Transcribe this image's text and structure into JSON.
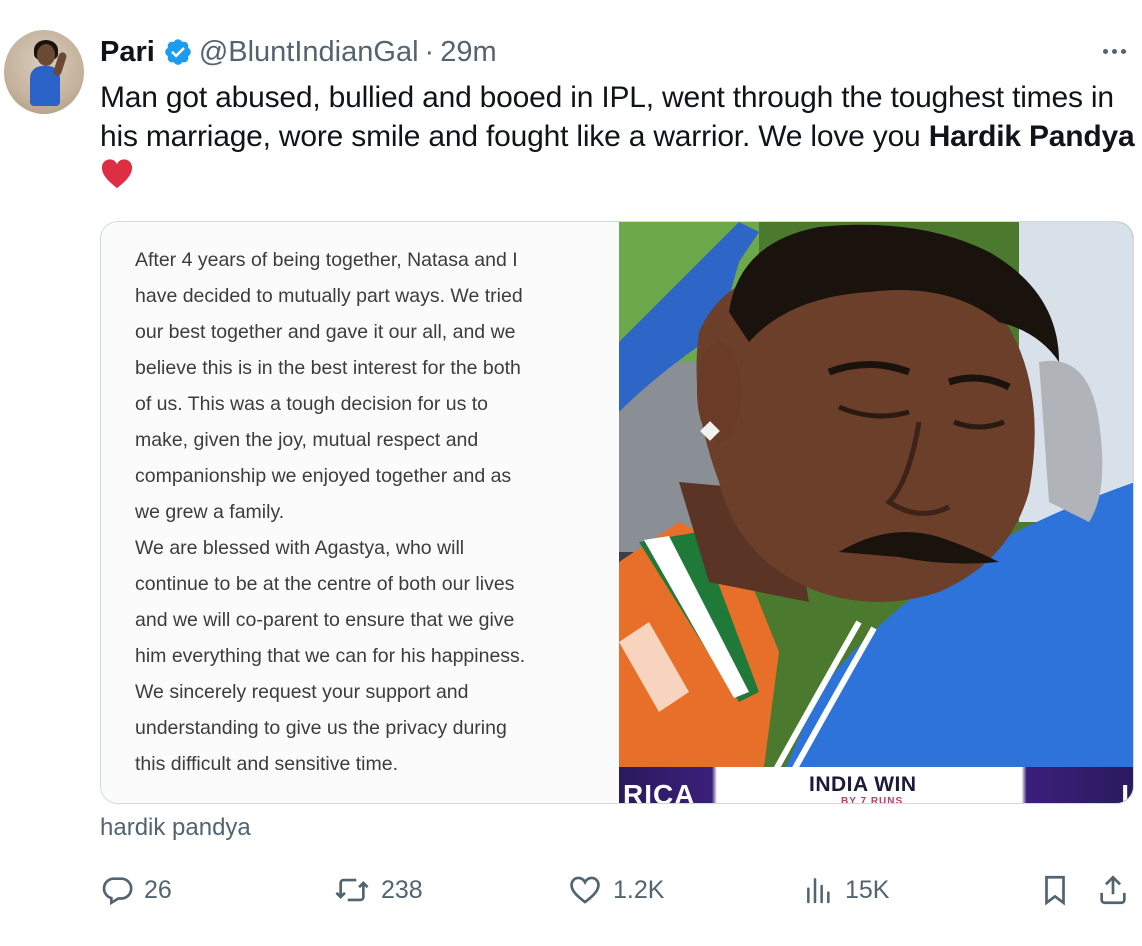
{
  "author": {
    "name": "Pari",
    "handle": "@BluntIndianGal",
    "separator": "·",
    "time": "29m"
  },
  "tweet": {
    "text_part1": "Man got abused, bullied and booed in IPL, went through the toughest times in his marriage, wore smile and fought like a warrior. We love you ",
    "text_bold": "Hardik Pandya",
    "emoji": "red-heart"
  },
  "media": {
    "notes_lines": [
      "After 4 years of being together, Natasa and I",
      "have decided to mutually part ways. We tried",
      "our best together and gave it our all, and we",
      "believe this is in the best interest for the both",
      "of us. This was a tough decision for us to",
      "make, given the joy, mutual respect and",
      "companionship we enjoyed together and as",
      "we grew a family.",
      "We are blessed with Agastya, who will",
      "continue to be at the centre of both our lives",
      "and we will co-parent to ensure that we give",
      "him everything that we can for his happiness.",
      "We sincerely request your support and",
      "understanding to give us the privacy during",
      "this difficult and sensitive time."
    ],
    "banner_left": "RICA",
    "banner_mid": "INDIA WIN",
    "banner_sub": "BY 7 RUNS",
    "banner_right": "I"
  },
  "card_caption": "hardik pandya",
  "actions": {
    "replies": "26",
    "reposts": "238",
    "likes": "1.2K",
    "views": "15K"
  },
  "colors": {
    "accent": "#1d9bf0",
    "muted": "#536471",
    "text": "#0f1419",
    "heart": "#e0245e"
  }
}
